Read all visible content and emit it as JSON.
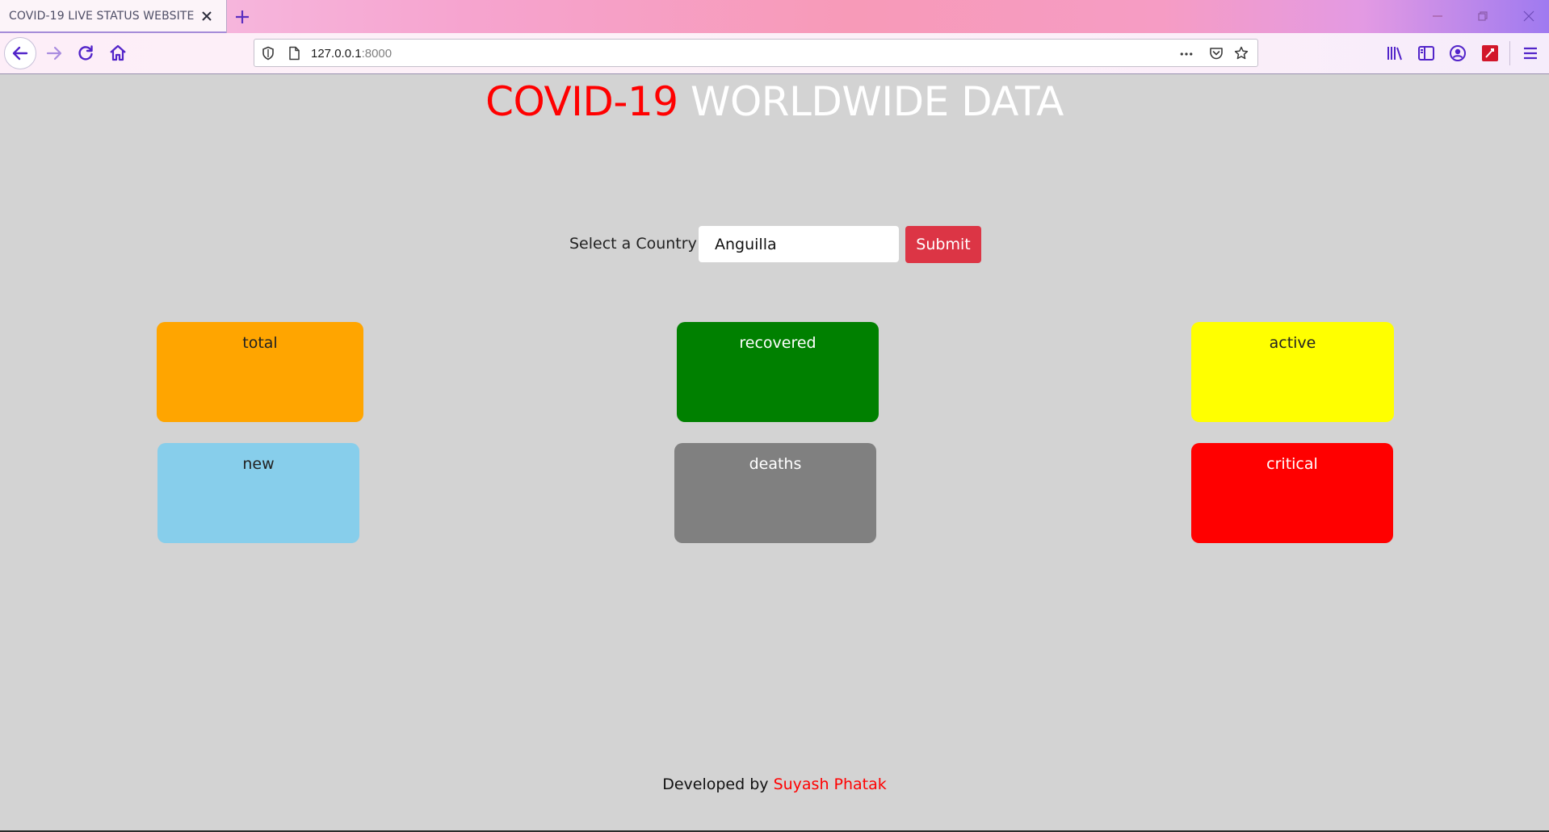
{
  "browser": {
    "tab_title": "COVID-19 LIVE STATUS WEBSITE",
    "url_host": "127.0.0.1",
    "url_port": ":8000"
  },
  "page": {
    "title_highlight": "COVID-19",
    "title_rest": "WORLDWIDE DATA",
    "form": {
      "label": "Select a Country :",
      "country_value": "Anguilla",
      "submit_label": "Submit"
    },
    "cards": [
      {
        "label": "total",
        "color": "#ffa500",
        "text_color": "#222222"
      },
      {
        "label": "recovered",
        "color": "#008000",
        "text_color": "#ffffff"
      },
      {
        "label": "active",
        "color": "#ffff00",
        "text_color": "#222222"
      },
      {
        "label": "new",
        "color": "#87ceeb",
        "text_color": "#222222"
      },
      {
        "label": "deaths",
        "color": "#808080",
        "text_color": "#ffffff"
      },
      {
        "label": "critical",
        "color": "#ff0000",
        "text_color": "#ffffff"
      }
    ],
    "footer": {
      "prefix": "Developed by",
      "author": "Suyash Phatak"
    }
  },
  "colors": {
    "background": "#d3d3d3",
    "accent_red": "#ff0000",
    "submit": "#dc3545"
  }
}
